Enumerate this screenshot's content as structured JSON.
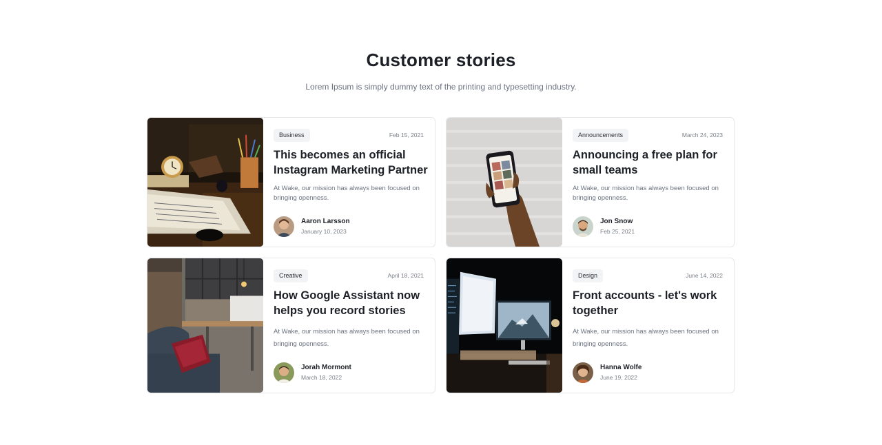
{
  "section": {
    "title": "Customer stories",
    "subtitle": "Lorem Ipsum is simply dummy text of the printing and typesetting industry."
  },
  "stories": [
    {
      "tag": "Business",
      "date": "Feb 15, 2021",
      "title": "This becomes an official Instagram Marketing Partner",
      "excerpt": "At Wake, our mission has always been focused on bringing openness.",
      "author": {
        "name": "Aaron Larsson",
        "date": "January 10, 2023"
      },
      "image": "desk-clock-book-photo"
    },
    {
      "tag": "Announcements",
      "date": "March 24, 2023",
      "title": "Announcing a free plan for small teams",
      "excerpt": "At Wake, our mission has always been focused on bringing openness.",
      "author": {
        "name": "Jon Snow",
        "date": "Feb 25, 2021"
      },
      "image": "hand-holding-phone-photo"
    },
    {
      "tag": "Creative",
      "date": "April 18, 2021",
      "title": "How Google Assistant now helps you record stories",
      "excerpt": "At Wake, our mission has always been focused on bringing openness.",
      "author": {
        "name": "Jorah Mormont",
        "date": "March 18, 2022"
      },
      "image": "living-room-kitchen-photo"
    },
    {
      "tag": "Design",
      "date": "June 14, 2022",
      "title": "Front accounts - let's work together",
      "excerpt": "At Wake, our mission has always been focused on bringing openness.",
      "author": {
        "name": "Hanna Wolfe",
        "date": "June 19, 2022"
      },
      "image": "computer-desk-night-photo"
    }
  ]
}
